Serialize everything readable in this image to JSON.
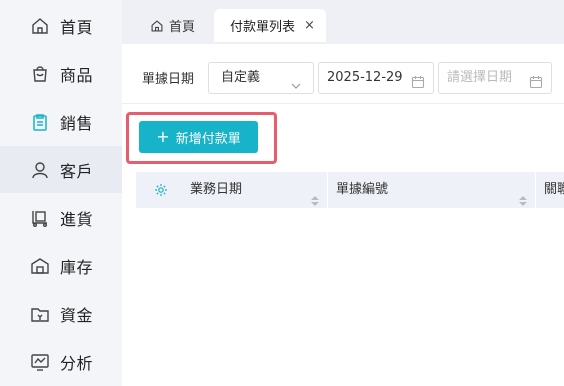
{
  "sidebar": {
    "items": [
      {
        "label": "首頁",
        "icon": "home-icon"
      },
      {
        "label": "商品",
        "icon": "bag-icon"
      },
      {
        "label": "銷售",
        "icon": "clipboard-icon"
      },
      {
        "label": "客戶",
        "icon": "user-icon"
      },
      {
        "label": "進貨",
        "icon": "cart-icon"
      },
      {
        "label": "庫存",
        "icon": "warehouse-icon"
      },
      {
        "label": "資金",
        "icon": "wallet-icon"
      },
      {
        "label": "分析",
        "icon": "chart-monitor-icon"
      }
    ],
    "active_index": 3
  },
  "tabs": {
    "home_label": "首頁",
    "active_label": "付款單列表",
    "close_glyph": "×"
  },
  "filters": {
    "label": "單據日期",
    "range_select_value": "自定義",
    "start_date": "2025-12-29",
    "end_date_placeholder": "請選擇日期"
  },
  "actions": {
    "add_label": "新增付款單"
  },
  "table": {
    "columns": [
      "業務日期",
      "單據編號",
      "關聯"
    ]
  },
  "colors": {
    "accent": "#17b3c9",
    "highlight_border": "#e85d6e",
    "sidebar_bg": "#f4f5f9",
    "table_header_bg": "#eef1f7"
  }
}
